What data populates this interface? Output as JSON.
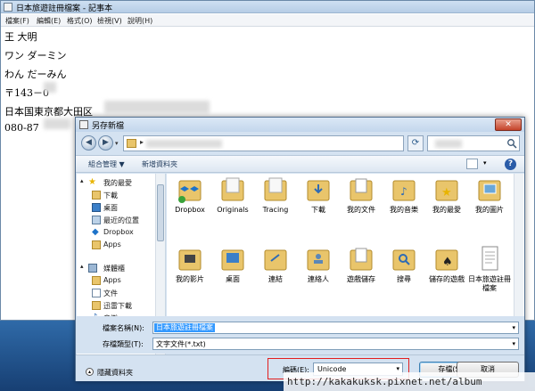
{
  "notepad": {
    "title": "日本旅遊註冊檔案 - 記事本",
    "menu": [
      "檔案(F)",
      "編輯(E)",
      "格式(O)",
      "檢視(V)",
      "說明(H)"
    ],
    "lines": [
      "王 大明",
      "ワン ダーミン",
      "わん だーみん",
      "〒143－0",
      "日本国東京都大田区",
      "080-87"
    ]
  },
  "dialog": {
    "title": "另存新檔",
    "close_label": "✕",
    "toolbar": {
      "organize": "組合管理 ▼",
      "new_folder": "新增資料夾"
    },
    "nav_items": [
      {
        "label": "我的最愛",
        "icon": "star-icon"
      },
      {
        "label": "下載",
        "icon": "download-folder-icon"
      },
      {
        "label": "桌面",
        "icon": "desktop-icon"
      },
      {
        "label": "最近的位置",
        "icon": "recent-places-icon"
      },
      {
        "label": "Dropbox",
        "icon": "dropbox-icon"
      },
      {
        "label": "Apps",
        "icon": "folder-icon"
      },
      {
        "label": "媒體櫃",
        "icon": "libraries-icon"
      },
      {
        "label": "Apps",
        "icon": "folder-icon"
      },
      {
        "label": "文件",
        "icon": "documents-icon"
      },
      {
        "label": "迅雷下載",
        "icon": "folder-icon"
      },
      {
        "label": "音樂",
        "icon": "music-icon"
      }
    ],
    "files": [
      "Dropbox",
      "Originals",
      "Tracing",
      "下載",
      "我的文件",
      "我的音樂",
      "我的最愛",
      "我的圖片",
      "我的影片",
      "桌面",
      "連結",
      "連絡人",
      "遊戲儲存",
      "搜尋",
      "儲存的遊戲",
      "日本旅遊註冊檔案"
    ],
    "filename_label": "檔案名稱(N):",
    "filename_value": "日本旅遊註冊檔案",
    "filetype_label": "存檔類型(T):",
    "filetype_value": "文字文件(*.txt)",
    "hide_folders": "隱藏資料夾",
    "encoding_label": "編碼(E):",
    "encoding_value": "Unicode",
    "save_label": "存檔(S)",
    "cancel_label": "取消"
  },
  "watermark": "http://kakakuksk.pixnet.net/album",
  "colors": {
    "selection": "#3399ff",
    "highlight_frame": "#e21f1f",
    "folder": "#e9c56b"
  }
}
